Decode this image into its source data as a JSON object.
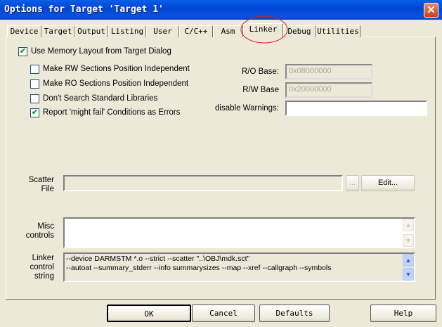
{
  "window": {
    "title": "Options for Target 'Target 1'"
  },
  "tabs": [
    {
      "label": "Device"
    },
    {
      "label": "Target"
    },
    {
      "label": "Output"
    },
    {
      "label": "Listing"
    },
    {
      "label": "User"
    },
    {
      "label": "C/C++"
    },
    {
      "label": "Asm"
    },
    {
      "label": "Linker",
      "selected": true
    },
    {
      "label": "Debug"
    },
    {
      "label": "Utilities"
    }
  ],
  "options": {
    "use_memory_layout": {
      "label": "Use Memory Layout from Target Dialog",
      "checked": true
    },
    "rw_pi": {
      "label": "Make RW Sections Position Independent",
      "checked": false
    },
    "ro_pi": {
      "label": "Make RO Sections Position Independent",
      "checked": false
    },
    "no_std_libs": {
      "label": "Don't Search Standard Libraries",
      "checked": false
    },
    "might_fail": {
      "label": "Report 'might fail' Conditions as Errors",
      "checked": true
    }
  },
  "fields": {
    "ro_base": {
      "label": "R/O Base:",
      "value": "0x08000000"
    },
    "rw_base": {
      "label": "R/W Base",
      "value": "0x20000000"
    },
    "disable_warnings": {
      "label": "disable Warnings:",
      "value": ""
    },
    "scatter_file": {
      "label1": "Scatter",
      "label2": "File",
      "value": "",
      "browse": "...",
      "edit": "Edit..."
    },
    "misc": {
      "label1": "Misc",
      "label2": "controls",
      "value": ""
    },
    "linker_control": {
      "label1": "Linker",
      "label2": "control",
      "label3": "string",
      "line1": "--device DARMSTM *.o --strict --scatter \"..\\OBJ\\mdk.sct\"",
      "line2": "--autoat --summary_stderr --info summarysizes --map --xref --callgraph --symbols"
    }
  },
  "buttons": {
    "ok": "OK",
    "cancel": "Cancel",
    "defaults": "Defaults",
    "help": "Help"
  },
  "check_glyph": "✔"
}
